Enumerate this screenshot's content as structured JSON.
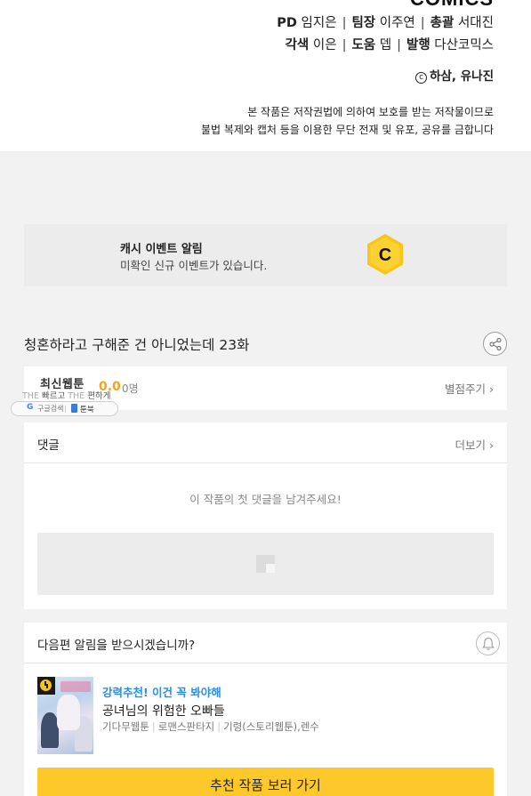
{
  "credits": {
    "logo_partial": "COMICS",
    "line1": [
      {
        "role": "PD",
        "name": "임지은"
      },
      {
        "role": "팀장",
        "name": "이주연"
      },
      {
        "role": "총괄",
        "name": "서대진"
      }
    ],
    "line2": [
      {
        "role": "각색",
        "name": "이은"
      },
      {
        "role": "도움",
        "name": "뎁"
      },
      {
        "role": "발행",
        "name": "다산코믹스"
      }
    ],
    "copyright_mark": "c",
    "copyright_text": "하삼, 유나진",
    "notice_line1": "본 작품은 저작권법에 의하여 보호를 받는 저작물이므로",
    "notice_line2": "불법 복제와 캡처 등을 이용한 무단 전재 및 유포, 공유를 금합니다"
  },
  "event_banner": {
    "title": "캐시 이벤트 알림",
    "subtitle": "미확인 신규 이벤트가 있습니다.",
    "icon": "cash-coin-icon",
    "coin_letter": "C"
  },
  "episode": {
    "title": "청혼하라고 구해준 건 아니었는데 23화",
    "share_icon": "share-icon"
  },
  "rating": {
    "score": "0.0",
    "count": "0명",
    "action_label": "별점주기"
  },
  "watermark": {
    "title": "최신웹툰",
    "tagline_the1": "THE",
    "tagline_word1": "빠르고",
    "tagline_the2": "THE",
    "tagline_word2": "편하게",
    "google_label": "구글검색",
    "bookmark_label": "툰북"
  },
  "comments": {
    "label": "댓글",
    "more_label": "더보기",
    "empty_message": "이 작품의 첫 댓글을 남겨주세요!"
  },
  "next_alert": {
    "label": "다음편 알림을 받으시겠습니까?",
    "bell_icon": "bell-icon"
  },
  "recommendation": {
    "tag": "강력추천! 이건 꼭 봐야해",
    "title": "공녀님의 위험한 오빠들",
    "genres": [
      "기다무웹툰",
      "로맨스판타지",
      "기령(스토리웹툰),렌수"
    ],
    "button_label": "추천 작품 보러 가기"
  },
  "colors": {
    "accent_yellow": "#fcc82a",
    "rating_orange": "#f2a51b",
    "tag_blue": "#2a8ee0",
    "background_gray": "#f2f2f2"
  }
}
